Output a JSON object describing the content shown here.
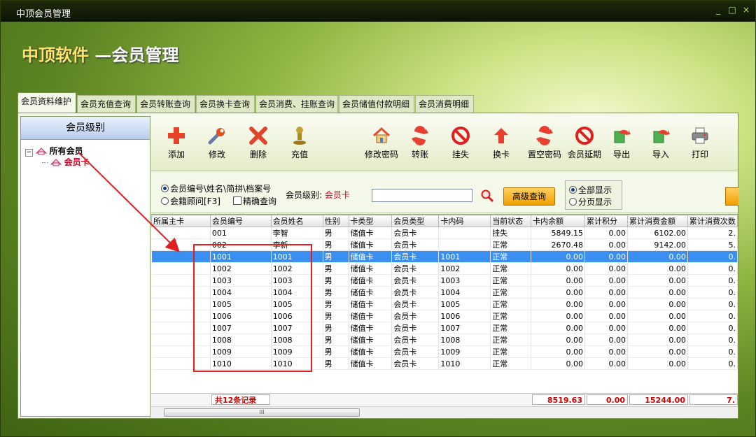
{
  "window": {
    "title": "中顶会员管理",
    "controls": [
      "_",
      "□",
      "×"
    ]
  },
  "brand": {
    "left": "中顶软件",
    "right": "—会员管理"
  },
  "tabs": [
    "会员资料维护",
    "会员充值查询",
    "会员转账查询",
    "会员换卡查询",
    "会员消费、挂账查询",
    "会员储值付款明细",
    "会员消费明细"
  ],
  "left_panel": {
    "title": "会员级别",
    "root": "所有会员",
    "child": "会员卡"
  },
  "toolbar": [
    "添加",
    "修改",
    "删除",
    "充值",
    "修改密码",
    "转账",
    "挂失",
    "换卡",
    "置空密码",
    "会员延期",
    "导出",
    "导入",
    "打印"
  ],
  "search": {
    "opt1": "会员编号\\姓名\\简拼\\档案号",
    "opt2": "会籍顾问[F3]",
    "exact": "精确查询",
    "level_label": "会员级别:",
    "level_value": "会员卡",
    "input_value": "",
    "advanced": "高级查询",
    "show_all": "全部显示",
    "paged": "分页显示"
  },
  "table": {
    "headers": [
      "所属主卡",
      "会员编号",
      "会员姓名",
      "性别",
      "卡类型",
      "会员类型",
      "卡内码",
      "当前状态",
      "卡内余额",
      "累计积分",
      "累计消费金额",
      "累计消费次数"
    ],
    "rows": [
      [
        "",
        "001",
        "李智",
        "男",
        "储值卡",
        "会员卡",
        "",
        "挂失",
        "5849.15",
        "0.00",
        "6102.00",
        "2."
      ],
      [
        "",
        "002",
        "李新",
        "男",
        "储值卡",
        "会员卡",
        "",
        "正常",
        "2670.48",
        "0.00",
        "9142.00",
        "5."
      ],
      [
        "",
        "1001",
        "1001",
        "男",
        "储值卡",
        "会员卡",
        "1001",
        "正常",
        "0.00",
        "0.00",
        "0.00",
        "0."
      ],
      [
        "",
        "1002",
        "1002",
        "男",
        "储值卡",
        "会员卡",
        "1002",
        "正常",
        "0.00",
        "0.00",
        "0.00",
        "0."
      ],
      [
        "",
        "1003",
        "1003",
        "男",
        "储值卡",
        "会员卡",
        "1003",
        "正常",
        "0.00",
        "0.00",
        "0.00",
        "0."
      ],
      [
        "",
        "1004",
        "1004",
        "男",
        "储值卡",
        "会员卡",
        "1004",
        "正常",
        "0.00",
        "0.00",
        "0.00",
        "0."
      ],
      [
        "",
        "1005",
        "1005",
        "男",
        "储值卡",
        "会员卡",
        "1005",
        "正常",
        "0.00",
        "0.00",
        "0.00",
        "0."
      ],
      [
        "",
        "1006",
        "1006",
        "男",
        "储值卡",
        "会员卡",
        "1006",
        "正常",
        "0.00",
        "0.00",
        "0.00",
        "0."
      ],
      [
        "",
        "1007",
        "1007",
        "男",
        "储值卡",
        "会员卡",
        "1007",
        "正常",
        "0.00",
        "0.00",
        "0.00",
        "0."
      ],
      [
        "",
        "1008",
        "1008",
        "男",
        "储值卡",
        "会员卡",
        "1008",
        "正常",
        "0.00",
        "0.00",
        "0.00",
        "0."
      ],
      [
        "",
        "1009",
        "1009",
        "男",
        "储值卡",
        "会员卡",
        "1009",
        "正常",
        "0.00",
        "0.00",
        "0.00",
        "0."
      ],
      [
        "",
        "1010",
        "1010",
        "男",
        "储值卡",
        "会员卡",
        "1010",
        "正常",
        "0.00",
        "0.00",
        "0.00",
        "0."
      ]
    ],
    "selected_row": 2
  },
  "footer": {
    "count": "共12条记录",
    "balance": "8519.63",
    "points": "0.00",
    "spend": "15244.00",
    "times": "7."
  },
  "scroll": {
    "thumb": "III"
  }
}
